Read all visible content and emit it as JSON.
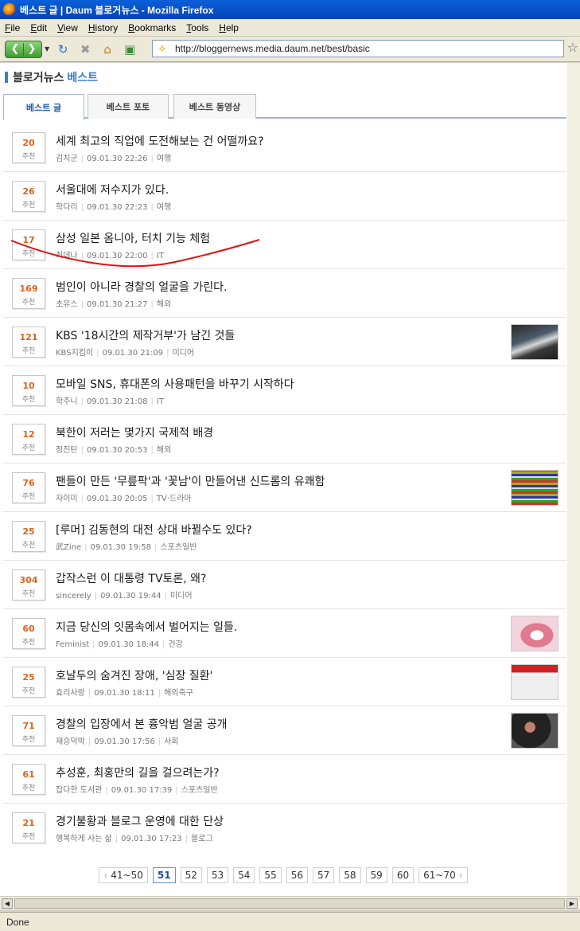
{
  "window": {
    "title": "베스트 글 | Daum 블로거뉴스 - Mozilla Firefox"
  },
  "menu": [
    "File",
    "Edit",
    "View",
    "History",
    "Bookmarks",
    "Tools",
    "Help"
  ],
  "toolbar": {
    "back_icon": "back-arrow-icon",
    "forward_icon": "forward-arrow-icon",
    "reload_icon": "reload-icon",
    "stop_icon": "stop-icon",
    "home_icon": "home-icon",
    "url": "http://bloggernews.media.daum.net/best/basic"
  },
  "page": {
    "header_prefix": "블로거뉴스",
    "header_suffix": "베스트",
    "accent_color": "#3c7fd1",
    "tabs": [
      {
        "label": "베스트 글",
        "active": true
      },
      {
        "label": "베스트 포토",
        "active": false
      },
      {
        "label": "베스트 동영상",
        "active": false
      }
    ],
    "rec_label": "추천",
    "posts": [
      {
        "count": "20",
        "title": "세계 최고의 직업에 도전해보는 건 어떨까요?",
        "author": "김치군",
        "date": "09.01.30 22:26",
        "category": "여행",
        "thumb": ""
      },
      {
        "count": "26",
        "title": "서울대에 저수지가 있다.",
        "author": "학다리",
        "date": "09.01.30 22:23",
        "category": "여행",
        "thumb": ""
      },
      {
        "count": "17",
        "title": "삼성 일본 옴니아, 터치 기능 체험",
        "author": "최데나",
        "date": "09.01.30 22:00",
        "category": "IT",
        "thumb": ""
      },
      {
        "count": "169",
        "title": "범인이 아니라 경찰의 얼굴을 가린다.",
        "author": "초유스",
        "date": "09.01.30 21:27",
        "category": "해외",
        "thumb": ""
      },
      {
        "count": "121",
        "title": "KBS '18시간의 제작거부'가 남긴 것들",
        "author": "KBS지킴이",
        "date": "09.01.30 21:09",
        "category": "미디어",
        "thumb": "protest-photo"
      },
      {
        "count": "10",
        "title": "모바일 SNS, 휴대폰의 사용패턴을 바꾸기 시작하다",
        "author": "학주니",
        "date": "09.01.30 21:08",
        "category": "IT",
        "thumb": ""
      },
      {
        "count": "12",
        "title": "북한이 저러는 몇가지 국제적 배경",
        "author": "정진탄",
        "date": "09.01.30 20:53",
        "category": "해외",
        "thumb": ""
      },
      {
        "count": "76",
        "title": "팬들이 만든 '무릎팍'과 '꽃남'이 만들어낸 신드롬의 유쾌함",
        "author": "자이미",
        "date": "09.01.30 20:05",
        "category": "TV·드라마",
        "thumb": "tv-photo"
      },
      {
        "count": "25",
        "title": "[루머] 김동현의 대전 상대 바뀔수도 있다?",
        "author": "武Zine",
        "date": "09.01.30 19:58",
        "category": "스포츠일반",
        "thumb": ""
      },
      {
        "count": "304",
        "title": "갑작스런 이 대통령 TV토론, 왜?",
        "author": "sincerely",
        "date": "09.01.30 19:44",
        "category": "미디어",
        "thumb": ""
      },
      {
        "count": "60",
        "title": "지금 당신의 잇몸속에서 벌어지는 일들.",
        "author": "Feminist",
        "date": "09.01.30 18:44",
        "category": "건강",
        "thumb": "teeth-photo"
      },
      {
        "count": "25",
        "title": "호날두의 숨겨진 장애, '심장 질환'",
        "author": "효리사랑",
        "date": "09.01.30 18:11",
        "category": "해외축구",
        "thumb": "newspaper-photo"
      },
      {
        "count": "71",
        "title": "경찰의 입장에서 본 흉악범 얼굴 공개",
        "author": "재승덕박",
        "date": "09.01.30 17:56",
        "category": "사회",
        "thumb": "police-photo"
      },
      {
        "count": "61",
        "title": "추성훈, 최홍만의 길을 걸으려는가?",
        "author": "잡다한 도서관",
        "date": "09.01.30 17:39",
        "category": "스포츠일반",
        "thumb": ""
      },
      {
        "count": "21",
        "title": "경기불황과 블로그 운영에 대한 단상",
        "author": "행복하게 사는 삶",
        "date": "09.01.30 17:23",
        "category": "블로그",
        "thumb": ""
      }
    ],
    "pagination": {
      "prev": "41~50",
      "pages": [
        "51",
        "52",
        "53",
        "54",
        "55",
        "56",
        "57",
        "58",
        "59",
        "60"
      ],
      "current": "51",
      "next": "61~70"
    }
  },
  "status": "Done"
}
